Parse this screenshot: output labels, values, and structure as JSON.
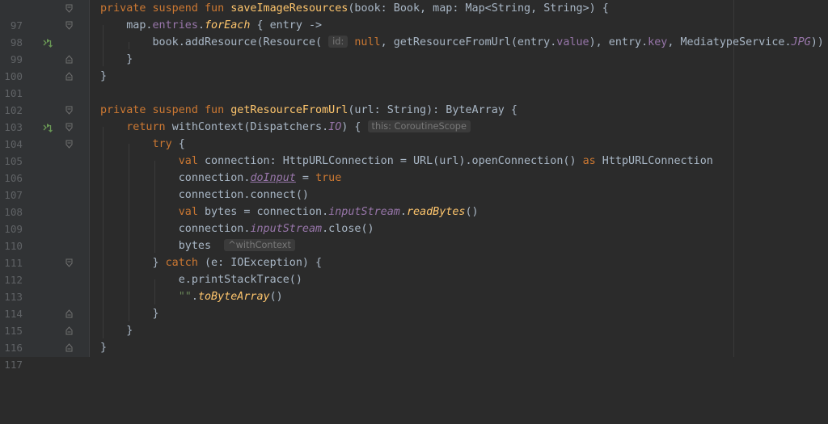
{
  "editor": {
    "lines": [
      {
        "number": "97"
      },
      {
        "number": "98"
      },
      {
        "number": "99"
      },
      {
        "number": "100"
      },
      {
        "number": "101"
      },
      {
        "number": "102"
      },
      {
        "number": "103"
      },
      {
        "number": "104"
      },
      {
        "number": "105"
      },
      {
        "number": "106"
      },
      {
        "number": "107"
      },
      {
        "number": "108"
      },
      {
        "number": "109"
      },
      {
        "number": "110"
      },
      {
        "number": "111"
      },
      {
        "number": "112"
      },
      {
        "number": "113"
      },
      {
        "number": "114"
      },
      {
        "number": "115"
      },
      {
        "number": "116"
      },
      {
        "number": "117"
      }
    ],
    "hints": {
      "id_param": "id:",
      "coroutine_scope": "this: CoroutineScope",
      "with_context_return": "^withContext"
    },
    "gutter_icons": {
      "suspend_call": "suspend-call-icon",
      "fold": "fold-icon"
    },
    "colors": {
      "background": "#2b2b2b",
      "gutter": "#313335",
      "keyword": "#cc7832",
      "function": "#ffc66d",
      "property": "#9876aa",
      "string": "#6a8759",
      "text": "#a9b7c6",
      "line_number": "#606366"
    }
  }
}
